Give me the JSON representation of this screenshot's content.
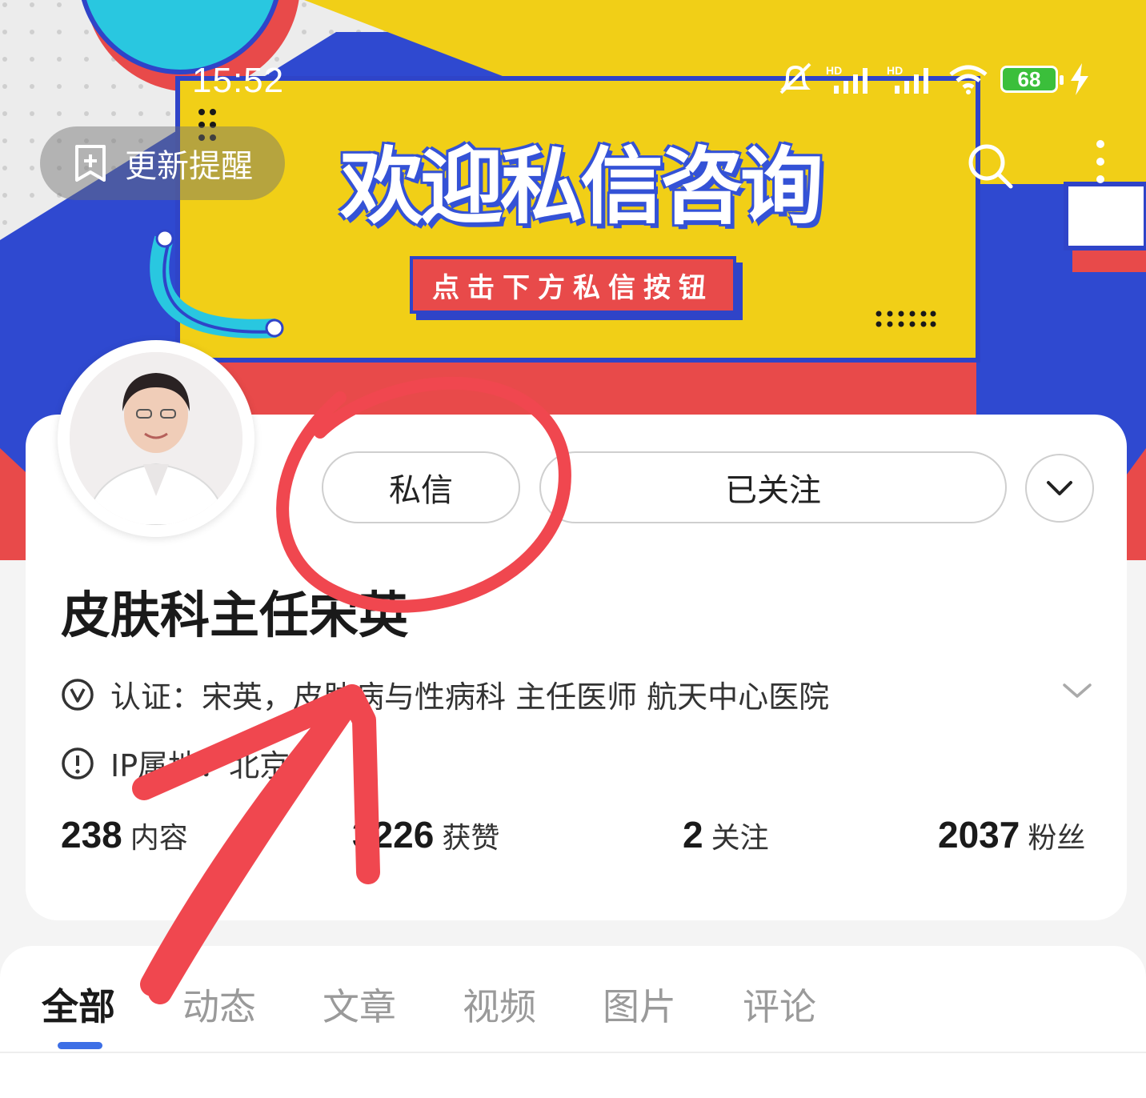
{
  "status_bar": {
    "time": "15:52",
    "battery": "68",
    "icons": [
      "mute-bell-icon",
      "hd-signal-icon",
      "hd-signal-icon",
      "wifi-icon",
      "battery-icon",
      "charging-icon"
    ]
  },
  "banner": {
    "update_button_label": "更新提醒",
    "title": "欢迎私信咨询",
    "subtitle": "点击下方私信按钮",
    "colors": {
      "yellow": "#f1cf17",
      "blue": "#2f44c8",
      "red": "#e84a4a",
      "cyan": "#29c7e0"
    }
  },
  "profile": {
    "message_button": "私信",
    "follow_button": "已关注",
    "name": "皮肤科主任宋英",
    "certification": "认证：宋英，皮肤病与性病科 主任医师 航天中心医院",
    "ip_location": "IP属地：北京"
  },
  "stats": [
    {
      "value": "238",
      "label": "内容"
    },
    {
      "value": "3226",
      "label": "获赞"
    },
    {
      "value": "2",
      "label": "关注"
    },
    {
      "value": "2037",
      "label": "粉丝"
    }
  ],
  "tabs": [
    "全部",
    "动态",
    "文章",
    "视频",
    "图片",
    "评论"
  ],
  "active_tab": "全部",
  "annotation_color": "#f0474f"
}
